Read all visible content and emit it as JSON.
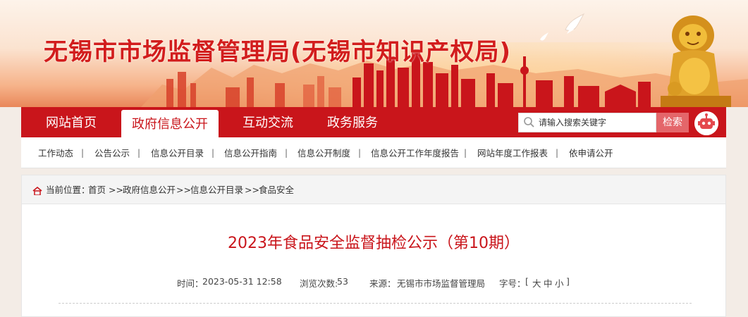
{
  "site": {
    "title": "无锡市市场监督管理局(无锡市知识产权局)"
  },
  "nav": {
    "items": [
      {
        "label": "网站首页"
      },
      {
        "label": "政府信息公开"
      },
      {
        "label": "互动交流"
      },
      {
        "label": "政务服务"
      }
    ],
    "active_index": 1
  },
  "search": {
    "placeholder": "请输入搜索关键字",
    "button_label": "检索"
  },
  "subnav": {
    "items": [
      {
        "label": "工作动态"
      },
      {
        "label": "公告公示"
      },
      {
        "label": "信息公开目录"
      },
      {
        "label": "信息公开指南"
      },
      {
        "label": "信息公开制度"
      },
      {
        "label": "信息公开工作年度报告"
      },
      {
        "label": "网站年度工作报表"
      },
      {
        "label": "依申请公开"
      }
    ],
    "separator": "|"
  },
  "breadcrumb": {
    "prefix": "当前位置：",
    "items": [
      "首页",
      "政府信息公开",
      "信息公开目录",
      "食品安全"
    ],
    "separator": ">>"
  },
  "article": {
    "title": "2023年食品安全监督抽检公示（第10期）",
    "meta": {
      "time_label": "时间：",
      "time": "2023-05-31 12:58",
      "views_label": "浏览次数:",
      "views": "53",
      "source_label": "来源：",
      "source": "无锡市市场监督管理局",
      "fontsize_label": "字号：",
      "fontsize_open": "[",
      "fontsize_options": [
        "大",
        "中",
        "小"
      ],
      "fontsize_close": "]"
    }
  },
  "colors": {
    "brand_red": "#c9151b",
    "title_red": "#d21d1d",
    "search_button": "#e4666a"
  },
  "icons": [
    "search-icon",
    "robot-icon",
    "home-icon",
    "lion-statue-icon",
    "dove-icon"
  ]
}
